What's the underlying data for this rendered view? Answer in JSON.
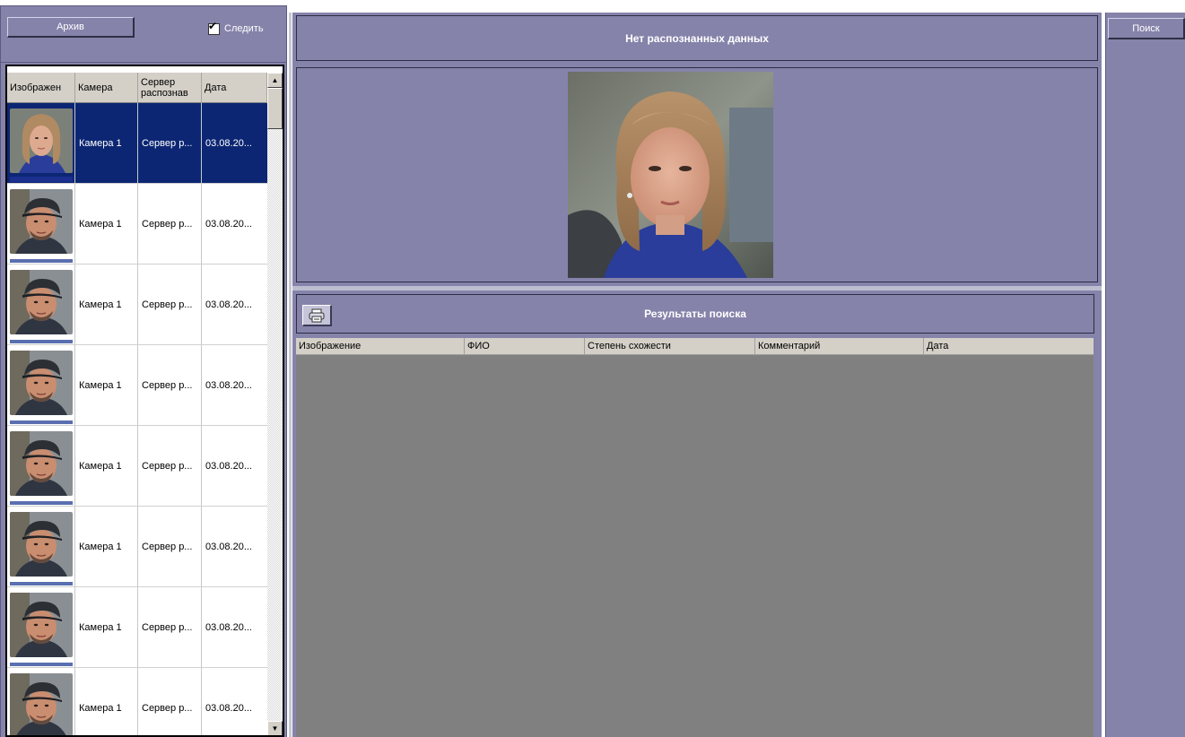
{
  "toolbar": {
    "archive_label": "Архив",
    "follow_label": "Следить",
    "follow_checked": true
  },
  "event_grid": {
    "columns": [
      "Изображен",
      "Камера",
      "Сервер распознав",
      "Дата"
    ],
    "rows": [
      {
        "camera": "Камера 1",
        "server": "Сервер р...",
        "date": "03.08.20...",
        "selected": true,
        "face": "woman"
      },
      {
        "camera": "Камера 1",
        "server": "Сервер р...",
        "date": "03.08.20...",
        "selected": false,
        "face": "man"
      },
      {
        "camera": "Камера 1",
        "server": "Сервер р...",
        "date": "03.08.20...",
        "selected": false,
        "face": "man"
      },
      {
        "camera": "Камера 1",
        "server": "Сервер р...",
        "date": "03.08.20...",
        "selected": false,
        "face": "man"
      },
      {
        "camera": "Камера 1",
        "server": "Сервер р...",
        "date": "03.08.20...",
        "selected": false,
        "face": "man"
      },
      {
        "camera": "Камера 1",
        "server": "Сервер р...",
        "date": "03.08.20...",
        "selected": false,
        "face": "man"
      },
      {
        "camera": "Камера 1",
        "server": "Сервер р...",
        "date": "03.08.20...",
        "selected": false,
        "face": "man"
      },
      {
        "camera": "Камера 1",
        "server": "Сервер р...",
        "date": "03.08.20...",
        "selected": false,
        "face": "man"
      }
    ]
  },
  "recognition": {
    "status_text": "Нет распознанных данных"
  },
  "results": {
    "title": "Результаты поиска",
    "columns": [
      "Изображение",
      "ФИО",
      "Степень схожести",
      "Комментарий",
      "Дата"
    ]
  },
  "right_panel": {
    "search_label": "Поиск"
  },
  "colors": {
    "panel": "#8583aa",
    "selection": "#0c2673",
    "results_background": "#808080"
  },
  "icons": {
    "print": "printer-icon",
    "scroll_up": "arrow-up-icon",
    "scroll_down": "arrow-down-icon",
    "check": "checkmark-icon"
  }
}
